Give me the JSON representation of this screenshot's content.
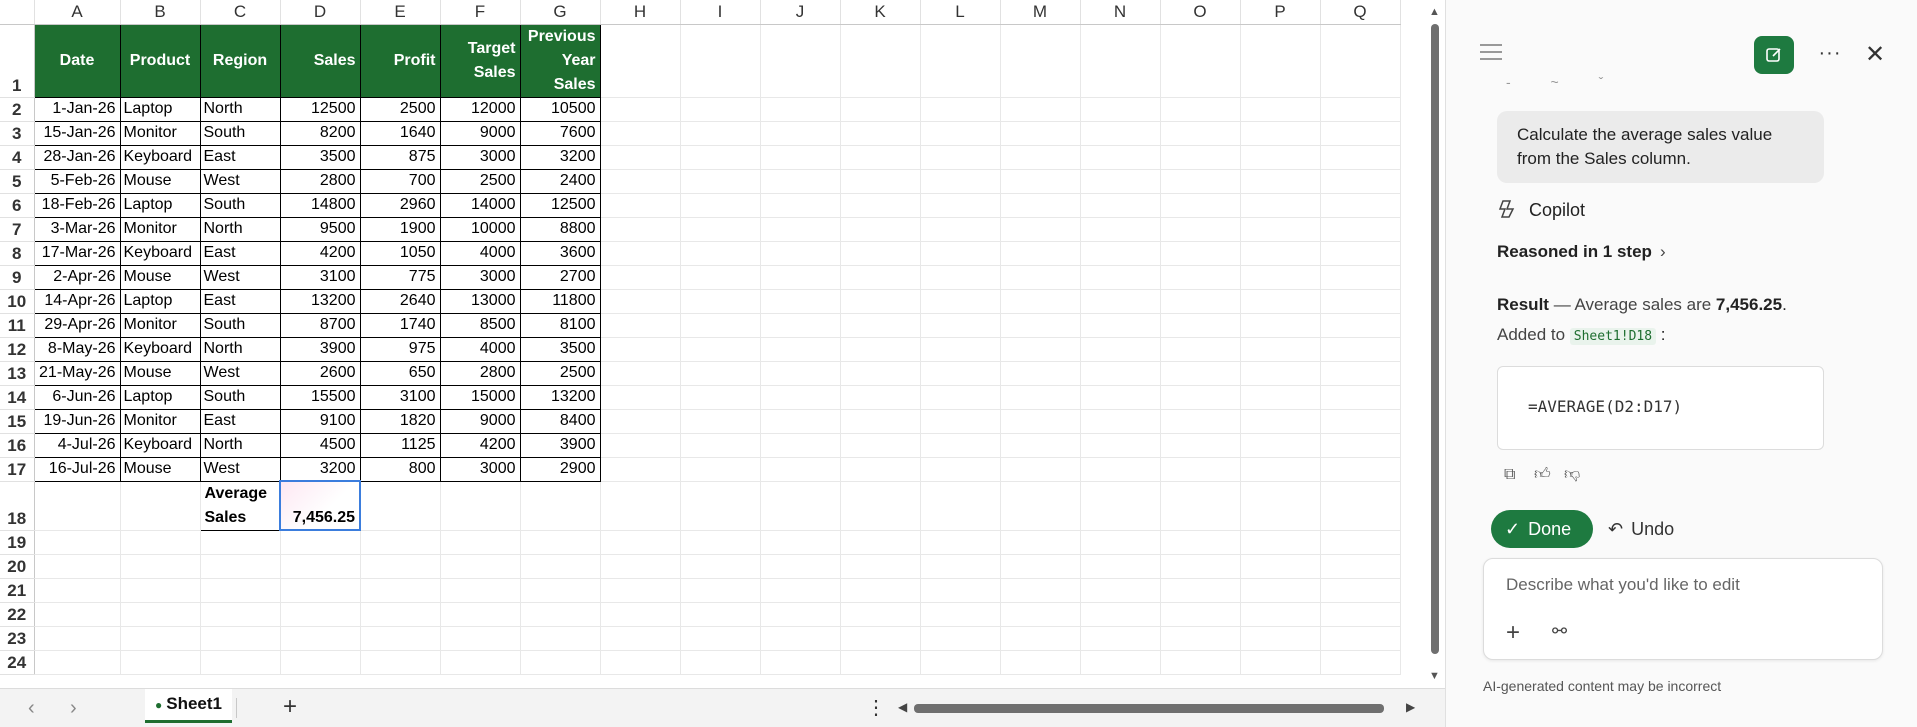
{
  "sheet": {
    "columns": [
      "A",
      "B",
      "C",
      "D",
      "E",
      "F",
      "G",
      "H",
      "I",
      "J",
      "K",
      "L",
      "M",
      "N",
      "O",
      "P",
      "Q"
    ],
    "rows": [
      "1",
      "2",
      "3",
      "4",
      "5",
      "6",
      "7",
      "8",
      "9",
      "10",
      "11",
      "12",
      "13",
      "14",
      "15",
      "16",
      "17",
      "18",
      "19",
      "20",
      "21",
      "22",
      "23",
      "24"
    ],
    "headers": [
      "Date",
      "Product",
      "Region",
      "Sales",
      "Profit",
      "Target Sales",
      "Previous Year Sales"
    ],
    "data": [
      [
        "1-Jan-26",
        "Laptop",
        "North",
        "12500",
        "2500",
        "12000",
        "10500"
      ],
      [
        "15-Jan-26",
        "Monitor",
        "South",
        "8200",
        "1640",
        "9000",
        "7600"
      ],
      [
        "28-Jan-26",
        "Keyboard",
        "East",
        "3500",
        "875",
        "3000",
        "3200"
      ],
      [
        "5-Feb-26",
        "Mouse",
        "West",
        "2800",
        "700",
        "2500",
        "2400"
      ],
      [
        "18-Feb-26",
        "Laptop",
        "South",
        "14800",
        "2960",
        "14000",
        "12500"
      ],
      [
        "3-Mar-26",
        "Monitor",
        "North",
        "9500",
        "1900",
        "10000",
        "8800"
      ],
      [
        "17-Mar-26",
        "Keyboard",
        "East",
        "4200",
        "1050",
        "4000",
        "3600"
      ],
      [
        "2-Apr-26",
        "Mouse",
        "West",
        "3100",
        "775",
        "3000",
        "2700"
      ],
      [
        "14-Apr-26",
        "Laptop",
        "East",
        "13200",
        "2640",
        "13000",
        "11800"
      ],
      [
        "29-Apr-26",
        "Monitor",
        "South",
        "8700",
        "1740",
        "8500",
        "8100"
      ],
      [
        "8-May-26",
        "Keyboard",
        "North",
        "3900",
        "975",
        "4000",
        "3500"
      ],
      [
        "21-May-26",
        "Mouse",
        "West",
        "2600",
        "650",
        "2800",
        "2500"
      ],
      [
        "6-Jun-26",
        "Laptop",
        "South",
        "15500",
        "3100",
        "15000",
        "13200"
      ],
      [
        "19-Jun-26",
        "Monitor",
        "East",
        "9100",
        "1820",
        "9000",
        "8400"
      ],
      [
        "4-Jul-26",
        "Keyboard",
        "North",
        "4500",
        "1125",
        "4200",
        "3900"
      ],
      [
        "16-Jul-26",
        "Mouse",
        "West",
        "3200",
        "800",
        "3000",
        "2900"
      ]
    ],
    "average_label": "Average Sales",
    "average_value": "7,456.25",
    "sheet_tab": "Sheet1",
    "accent_color": "#1e6e30"
  },
  "pane": {
    "user_message": "Calculate the average sales value from the Sales column.",
    "assistant_name": "Copilot",
    "reasoned": "Reasoned in 1 step",
    "result_label": "Result",
    "result_text": " — Average sales are ",
    "result_value": "7,456.25",
    "result_end": ".",
    "added_to": "Added to ",
    "cell_ref": "Sheet1!D18",
    "colon": " :",
    "formula": "=AVERAGE(D2:D17)",
    "done_label": "Done",
    "undo_label": "Undo",
    "input_placeholder": "Describe what you'd like to edit",
    "disclaimer": "AI-generated content may be incorrect",
    "button_color": "#1e7a40"
  }
}
